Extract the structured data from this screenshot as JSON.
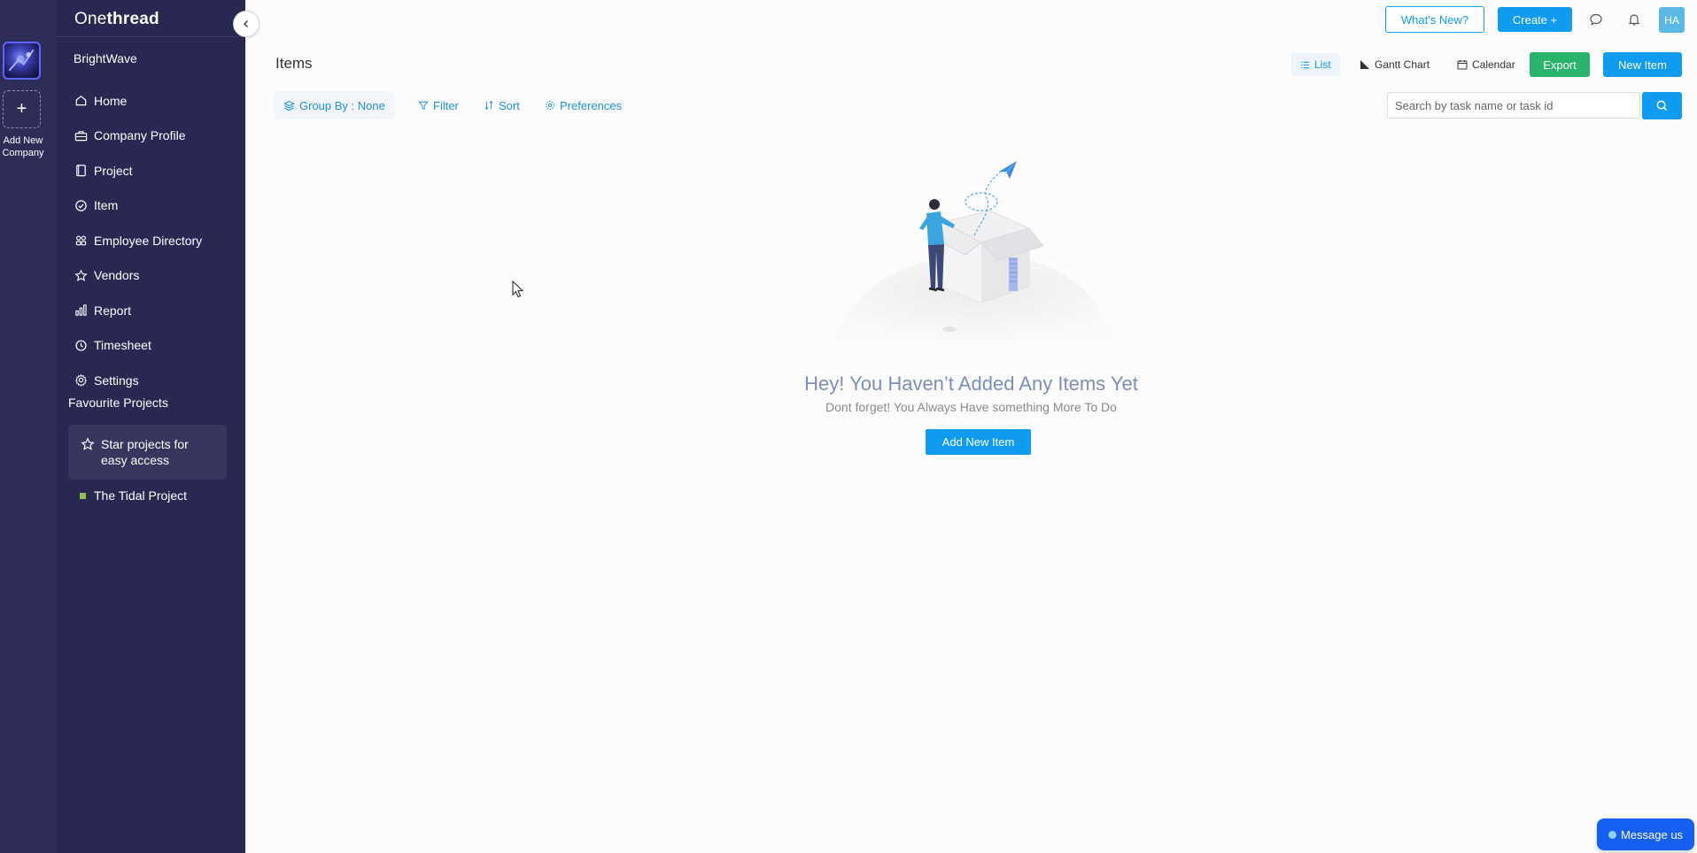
{
  "rail": {
    "add_company_label": "Add New Company",
    "add_icon": "plus-icon"
  },
  "sidebar": {
    "brand_prefix": "One",
    "brand_suffix": "thread",
    "workspace": "BrightWave",
    "items": [
      {
        "label": "Home",
        "icon": "home-icon"
      },
      {
        "label": "Company Profile",
        "icon": "briefcase-icon"
      },
      {
        "label": "Project",
        "icon": "document-icon"
      },
      {
        "label": "Item",
        "icon": "check-circle-icon"
      },
      {
        "label": "Employee Directory",
        "icon": "users-icon"
      },
      {
        "label": "Vendors",
        "icon": "star-icon"
      },
      {
        "label": "Report",
        "icon": "bar-chart-icon"
      },
      {
        "label": "Timesheet",
        "icon": "clock-icon"
      },
      {
        "label": "Settings",
        "icon": "gear-icon"
      }
    ],
    "favourites_title": "Favourite Projects",
    "star_hint": "Star projects for easy access",
    "projects": [
      {
        "label": "The Tidal Project",
        "color": "#8bc34a"
      }
    ]
  },
  "header": {
    "whats_new": "What's New?",
    "create": "Create +",
    "avatar_initials": "HA"
  },
  "page": {
    "title": "Items",
    "views": {
      "list": "List",
      "gantt": "Gantt Chart",
      "calendar": "Calendar"
    },
    "export": "Export",
    "new_item": "New Item",
    "toolbar": {
      "group_by": "Group By :",
      "group_value": "None",
      "filter": "Filter",
      "sort": "Sort",
      "preferences": "Preferences"
    },
    "search_placeholder": "Search by task name or task id"
  },
  "empty_state": {
    "title": "Hey! You Haven’t Added Any Items Yet",
    "subtitle": "Dont forget! You Always Have something More To Do",
    "cta": "Add New Item"
  },
  "chat": {
    "label": "Message us"
  },
  "colors": {
    "accent": "#0e9bf0",
    "export_green": "#29b36b",
    "sidebar_bg": "#292852"
  }
}
